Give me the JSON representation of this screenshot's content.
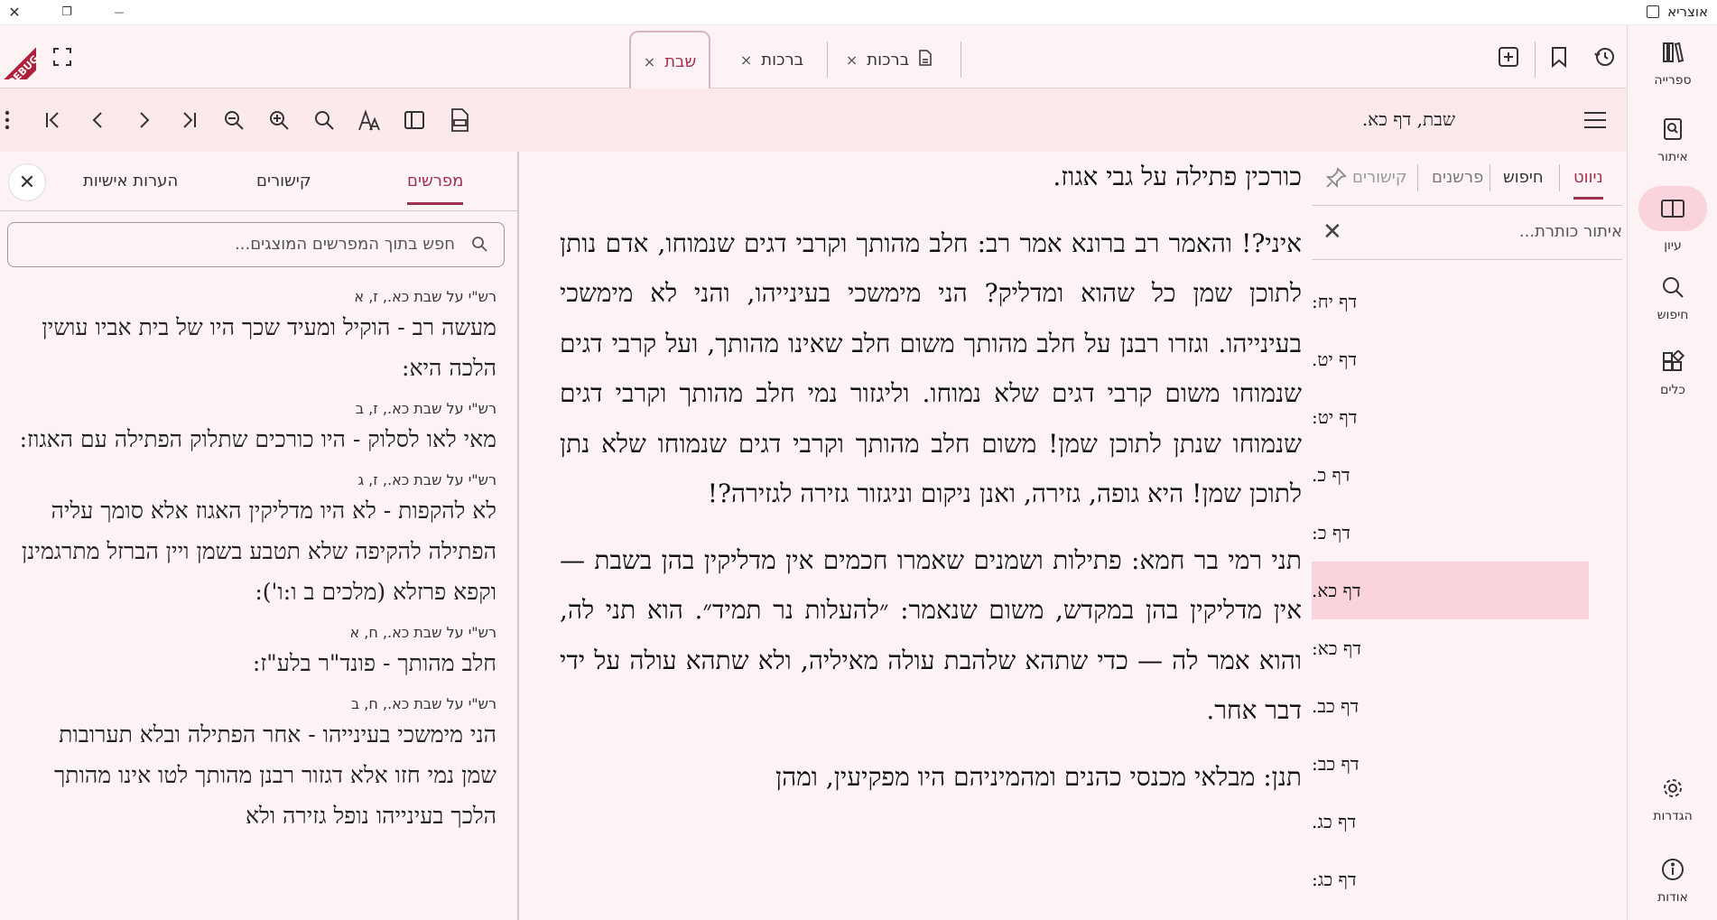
{
  "window": {
    "app_title": "אוצריא",
    "close_glyph": "✕",
    "restore_glyph": "❐",
    "minimize_glyph": "—"
  },
  "sidebar": {
    "items": [
      {
        "label": "ספרייה",
        "icon": "library-icon"
      },
      {
        "label": "איתור",
        "icon": "find-ref-icon"
      },
      {
        "label": "עיון",
        "icon": "book-open-icon"
      },
      {
        "label": "חיפוש",
        "icon": "search-icon"
      },
      {
        "label": "כלים",
        "icon": "tools-icon"
      },
      {
        "label": "הגדרות",
        "icon": "settings-icon"
      },
      {
        "label": "אודות",
        "icon": "info-icon"
      }
    ]
  },
  "tabs": {
    "items": [
      {
        "label": "שבת",
        "close": "×"
      },
      {
        "label": "ברכות",
        "close": "×"
      },
      {
        "label": "ברכות",
        "close": "×"
      }
    ],
    "debug_banner": "DEBUG"
  },
  "toolbar": {
    "title": "שבת, דף כא."
  },
  "navigation": {
    "tabs": [
      "ניווט",
      "חיפוש",
      "פרשנים",
      "קישורים"
    ],
    "filter_placeholder": "איתור כותרת...",
    "clear_glyph": "✕",
    "rows": [
      "דף יח:",
      "דף יט.",
      "דף יט:",
      "דף כ.",
      "דף כ:",
      "דף כא.",
      "דף כא:",
      "דף כב.",
      "דף כב:",
      "דף כג.",
      "דף כג:"
    ],
    "selected_index": 5
  },
  "main": {
    "paragraphs": [
      "כורכין פתילה על גבי אגוז.",
      "איני?! והאמר רב ברונא אמר רב: חלב מהותך וקרבי דגים שנמוחו, אדם נותן לתוכן שמן כל שהוא ומדליק? הני מימשכי בעינייהו, והני לא מימשכי בעינייהו. וגזרו רבנן על חלב מהותך משום חלב שאינו מהותך, ועל קרבי דגים שנמוחו משום קרבי דגים שלא נמוחו. וליגזור נמי חלב מהותך וקרבי דגים שנמוחו שנתן לתוכן שמן! משום חלב מהותך וקרבי דגים שנמוחו שלא נתן לתוכן שמן! היא גופה, גזירה, ואנן ניקום וניגזור גזירה לגזירה?!",
      "תני רמי בר חמא: פתילות ושמנים שאמרו חכמים אין מדליקין בהן בשבת — אין מדליקין בהן במקדש, משום שנאמר: ״להעלות נר תמיד״. הוא תני לה, והוא אמר לה — כדי שתהא שלהבת עולה מאיליה, ולא שתהא עולה על ידי דבר אחר.",
      "תנן: מבלאי מכנסי כהנים ומהמיניהם היו מפקיעין, ומהן"
    ]
  },
  "commentary": {
    "tabs": [
      "מפרשים",
      "קישורים",
      "הערות אישיות"
    ],
    "close_glyph": "✕",
    "search_placeholder": "חפש בתוך המפרשים המוצגים...",
    "items": [
      {
        "source": "רש\"י על שבת כא., ז, א",
        "text": "מעשה רב - הוקיל ומעיד שכך היו של בית אביו עושין הלכה היא:"
      },
      {
        "source": "רש\"י על שבת כא., ז, ב",
        "text": "מאי לאו לסלוק - היו כורכים שתלוק הפתילה עם האגוז:"
      },
      {
        "source": "רש\"י על שבת כא., ז, ג",
        "text": "לא להקפות - לא היו מדליקין האגוז אלא סומך עליה הפתילה להקיפה שלא תטבע בשמן ויין הברזל מתרגמינן וקפא פרזלא (מלכים ב ו:ו'):"
      },
      {
        "source": "רש\"י על שבת כא., ח, א",
        "text": "חלב מהותך - פונד\"ר בלע\"ז:"
      },
      {
        "source": "רש\"י על שבת כא., ח, ב",
        "text": "הני מימשכי בעינייהו - אחר הפתילה ובלא תערובות שמן נמי חזו אלא דגזור רבנן מהותך לטו אינו מהותך הלכך בעינייהו נופל גזירה ולא"
      }
    ]
  }
}
